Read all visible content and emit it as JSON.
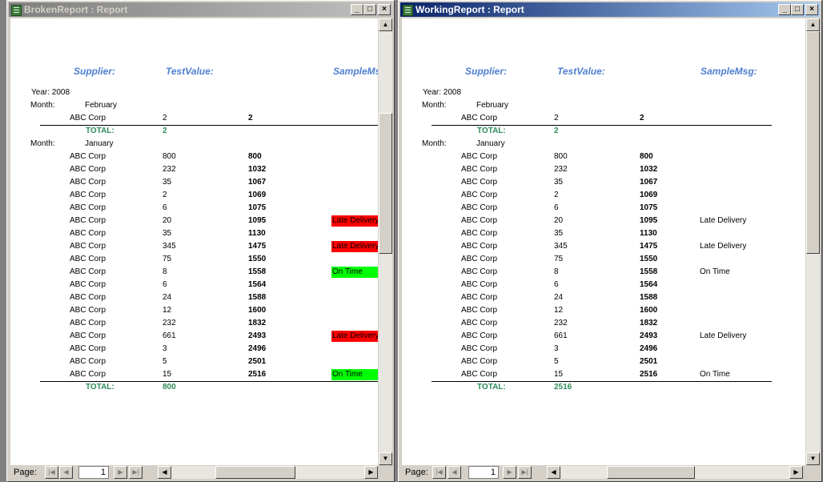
{
  "windows": [
    {
      "title": "BrokenReport : Report",
      "status": {
        "page_label": "Page:",
        "page_value": "1"
      }
    },
    {
      "title": "WorkingReport : Report",
      "status": {
        "page_label": "Page:",
        "page_value": "1"
      }
    }
  ],
  "headers": {
    "supplier": "Supplier:",
    "testvalue": "TestValue:",
    "samplemsg": "SampleMsg:",
    "samplemsg_cut": "SampleMs"
  },
  "year_label": "Year: 2008",
  "month_label": "Month:",
  "groups": [
    {
      "month": "February",
      "rows": [
        {
          "supplier": "ABC Corp",
          "value": "2",
          "running": "2",
          "msg": ""
        }
      ],
      "total_label": "TOTAL:",
      "total_broken": "2",
      "total_working": "2"
    },
    {
      "month": "January",
      "rows": [
        {
          "supplier": "ABC Corp",
          "value": "800",
          "running": "800",
          "msg": ""
        },
        {
          "supplier": "ABC Corp",
          "value": "232",
          "running": "1032",
          "msg": ""
        },
        {
          "supplier": "ABC Corp",
          "value": "35",
          "running": "1067",
          "msg": ""
        },
        {
          "supplier": "ABC Corp",
          "value": "2",
          "running": "1069",
          "msg": ""
        },
        {
          "supplier": "ABC Corp",
          "value": "6",
          "running": "1075",
          "msg": ""
        },
        {
          "supplier": "ABC Corp",
          "value": "20",
          "running": "1095",
          "msg": "Late Delivery",
          "color": "red"
        },
        {
          "supplier": "ABC Corp",
          "value": "35",
          "running": "1130",
          "msg": ""
        },
        {
          "supplier": "ABC Corp",
          "value": "345",
          "running": "1475",
          "msg": "Late Delivery",
          "color": "red"
        },
        {
          "supplier": "ABC Corp",
          "value": "75",
          "running": "1550",
          "msg": ""
        },
        {
          "supplier": "ABC Corp",
          "value": "8",
          "running": "1558",
          "msg": "On Time",
          "color": "green"
        },
        {
          "supplier": "ABC Corp",
          "value": "6",
          "running": "1564",
          "msg": ""
        },
        {
          "supplier": "ABC Corp",
          "value": "24",
          "running": "1588",
          "msg": ""
        },
        {
          "supplier": "ABC Corp",
          "value": "12",
          "running": "1600",
          "msg": ""
        },
        {
          "supplier": "ABC Corp",
          "value": "232",
          "running": "1832",
          "msg": ""
        },
        {
          "supplier": "ABC Corp",
          "value": "661",
          "running": "2493",
          "msg": "Late Delivery",
          "color": "red"
        },
        {
          "supplier": "ABC Corp",
          "value": "3",
          "running": "2496",
          "msg": ""
        },
        {
          "supplier": "ABC Corp",
          "value": "5",
          "running": "2501",
          "msg": ""
        },
        {
          "supplier": "ABC Corp",
          "value": "15",
          "running": "2516",
          "msg": "On Time",
          "color": "green"
        }
      ],
      "total_label": "TOTAL:",
      "total_broken": "800",
      "total_working": "2516"
    }
  ],
  "colors": {
    "red": "#ff0000",
    "green": "#00ff00",
    "header": "#4f7fd0",
    "total": "#2e8b57"
  }
}
